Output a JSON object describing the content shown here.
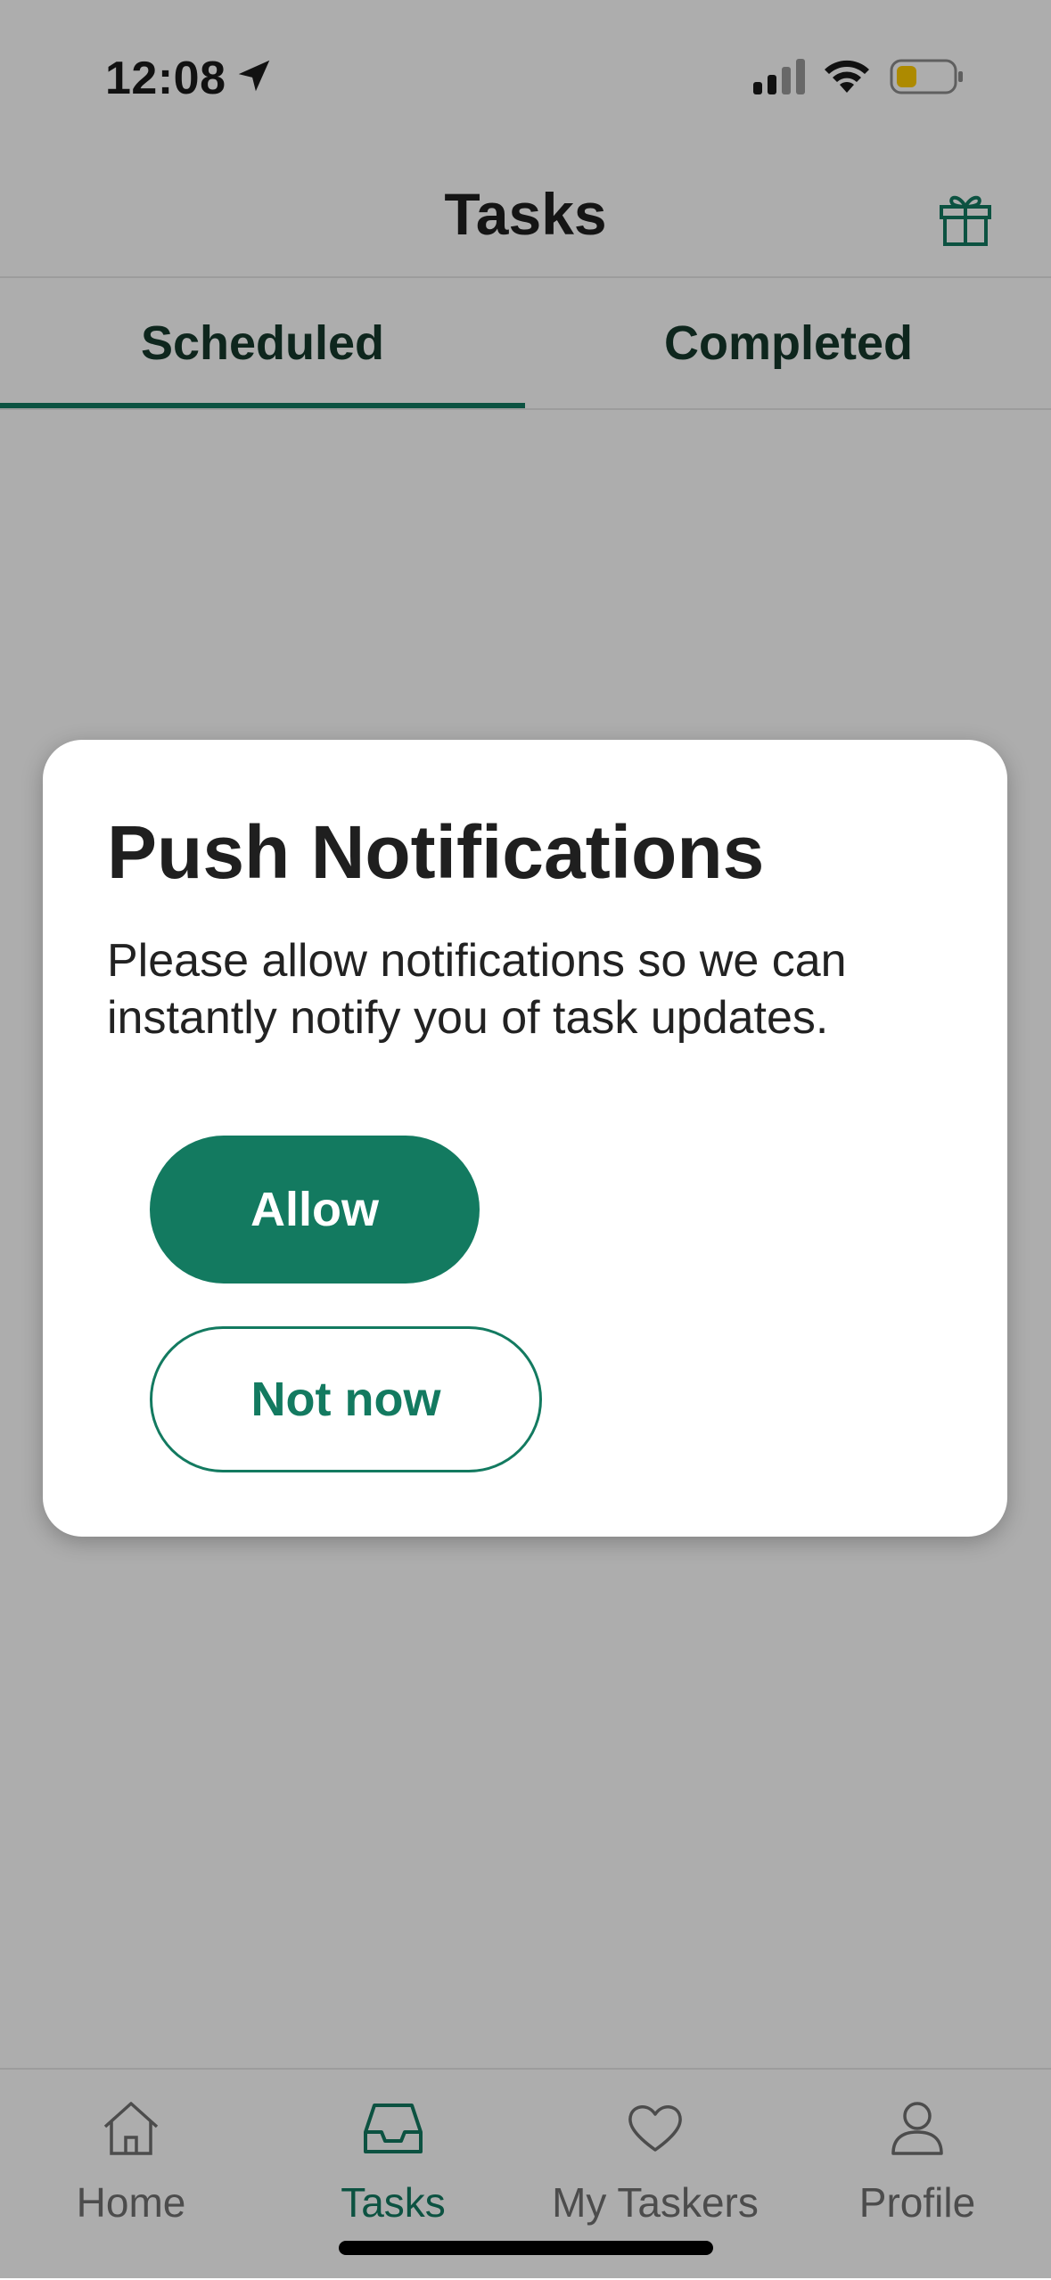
{
  "status_bar": {
    "time": "12:08",
    "icons": [
      "location-arrow-icon",
      "cellular-signal-icon",
      "wifi-icon",
      "battery-low-power-icon"
    ]
  },
  "header": {
    "title": "Tasks",
    "right_icon": "gift-icon"
  },
  "tabs": [
    {
      "label": "Scheduled",
      "active": true
    },
    {
      "label": "Completed",
      "active": false
    }
  ],
  "dialog": {
    "title": "Push Notifications",
    "body": "Please allow notifications so we can instantly notify you of task updates.",
    "allow_label": "Allow",
    "not_now_label": "Not now"
  },
  "bottom_nav": [
    {
      "label": "Home",
      "icon": "home-icon",
      "active": false
    },
    {
      "label": "Tasks",
      "icon": "inbox-tray-icon",
      "active": true
    },
    {
      "label": "My Taskers",
      "icon": "heart-icon",
      "active": false
    },
    {
      "label": "Profile",
      "icon": "person-icon",
      "active": false
    }
  ],
  "colors": {
    "accent": "#137a60",
    "overlay": "rgba(0,0,0,0.32)",
    "text_dark": "#1f1f1f",
    "nav_inactive": "#707070",
    "battery_low_power": "#ffcc00"
  }
}
